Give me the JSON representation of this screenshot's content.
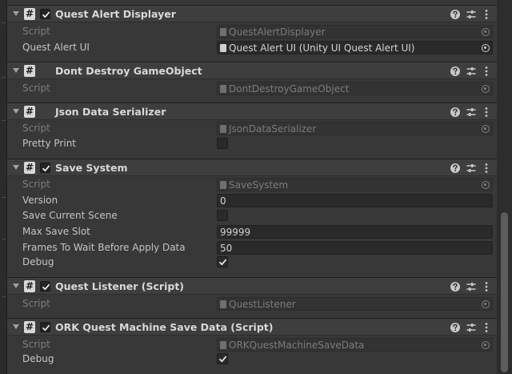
{
  "components": [
    {
      "title": "Quest Alert Displayer",
      "has_checkbox": true,
      "enabled": true,
      "fields": [
        {
          "label": "Script",
          "type": "script",
          "value": "QuestAlertDisplayer"
        },
        {
          "label": "Quest Alert UI",
          "type": "object",
          "value": "Quest Alert UI (Unity UI Quest Alert UI)"
        }
      ]
    },
    {
      "title": "Dont Destroy GameObject",
      "has_checkbox": false,
      "fields": [
        {
          "label": "Script",
          "type": "script",
          "value": "DontDestroyGameObject"
        }
      ]
    },
    {
      "title": "Json Data Serializer",
      "has_checkbox": false,
      "fields": [
        {
          "label": "Script",
          "type": "script",
          "value": "JsonDataSerializer"
        },
        {
          "label": "Pretty Print",
          "type": "toggle",
          "checked": false
        }
      ]
    },
    {
      "title": "Save System",
      "has_checkbox": true,
      "enabled": true,
      "fields": [
        {
          "label": "Script",
          "type": "script",
          "value": "SaveSystem"
        },
        {
          "label": "Version",
          "type": "text",
          "value": "0"
        },
        {
          "label": "Save Current Scene",
          "type": "toggle",
          "checked": false
        },
        {
          "label": "Max Save Slot",
          "type": "text",
          "value": "99999"
        },
        {
          "label": "Frames To Wait Before Apply Data",
          "type": "text",
          "value": "50"
        },
        {
          "label": "Debug",
          "type": "toggle",
          "checked": true,
          "modified": true
        }
      ]
    },
    {
      "title": "Quest Listener (Script)",
      "has_checkbox": true,
      "enabled": true,
      "fields": [
        {
          "label": "Script",
          "type": "script",
          "value": "QuestListener"
        }
      ]
    },
    {
      "title": "ORK Quest Machine Save Data (Script)",
      "has_checkbox": true,
      "enabled": true,
      "fields": [
        {
          "label": "Script",
          "type": "script",
          "value": "ORKQuestMachineSaveData"
        },
        {
          "label": "Debug",
          "type": "toggle",
          "checked": true,
          "modified": true
        }
      ]
    }
  ],
  "icons": {
    "component": "script-hash-icon",
    "help": "help-icon",
    "presets": "presets-sliders-icon",
    "menu": "kebab-menu-icon",
    "picker": "object-picker-icon",
    "fold": "foldout-arrow-icon"
  },
  "colors": {
    "background": "#383838",
    "header": "#3e3e3e",
    "field": "#2a2a2a",
    "text": "#c4c4c4",
    "modified_marker": "#4a8ac7"
  }
}
